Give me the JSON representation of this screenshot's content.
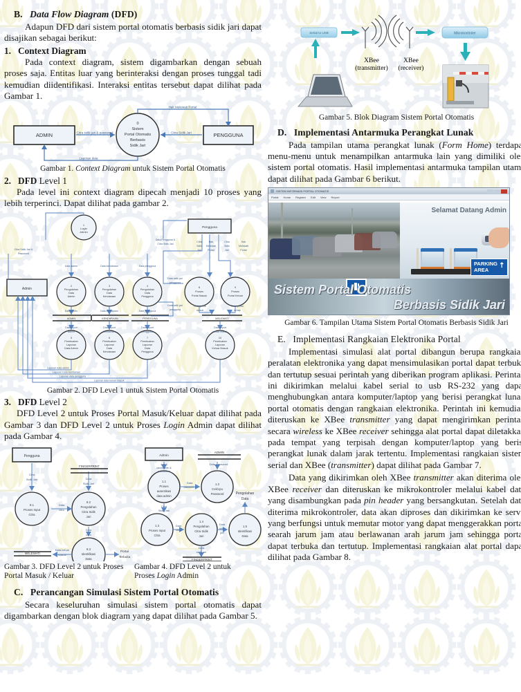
{
  "document": {
    "language": "id",
    "watermark": "its-gear-lotus-logo"
  },
  "left_column": {
    "section_b": {
      "letter": "B.",
      "title_italic": "Data Flow Diagram",
      "title_rest": "(DFD)",
      "para": "Adapun DFD dari sistem portal otomatis berbasis sidik jari dapat disajikan sebagai berikut:"
    },
    "item1": {
      "num": "1.",
      "title": "Context Diagram",
      "para": "Pada context diagram, sistem digambarkan dengan sebuah proses saja. Entitas luar yang berinteraksi dengan proses tunggal tadi kemudian diidentifikasi. Interaksi entitas tersebut dapat dilihat pada Gambar 1."
    },
    "figure1": {
      "caption_pre": "Gambar 1. ",
      "caption_italic": "Context Diagram",
      "caption_post": " untuk Sistem Portal Otomatis",
      "entities": [
        "ADMIN",
        "PENGGUNA"
      ],
      "process": [
        "0",
        "Sistem",
        "Portal Otomatis",
        "Berbasis",
        "Sidik Jari"
      ],
      "flows": [
        "Hak Melewati Portal",
        "Citra sidik jari & password",
        "Citra Sidik Jari",
        "Laporan data"
      ]
    },
    "item2": {
      "num": "2.",
      "title_bold": "DFD",
      "title_rest": " Level 1",
      "para": "Pada level ini context diagram dipecah menjadi 10 proses yang lebih terperinci. Dapat dilihat pada gambar 2."
    },
    "figure2": {
      "caption": "Gambar 2. DFD Level 1 untuk Sistem Portal Otomatis",
      "external_entities": [
        "Admin",
        "Pengguna"
      ],
      "processes": [
        {
          "id": "1",
          "label": "Login Admin"
        },
        {
          "id": "2",
          "label": "Pengolahan Data Admin"
        },
        {
          "id": "3",
          "label": "Pengolahan Data Kendaraan"
        },
        {
          "id": "4",
          "label": "Pengolahan Data Pengguna"
        },
        {
          "id": "8",
          "label": "Proses Portal Masuk"
        },
        {
          "id": "9",
          "label": "Proses Portal Keluar"
        },
        {
          "id": "5",
          "label": "Pembuatan Laporan Data Admin"
        },
        {
          "id": "6",
          "label": "Pembuatan Laporan Data Kendaraan"
        },
        {
          "id": "7",
          "label": "Pembuatan Laporan Data Pengguna"
        },
        {
          "id": "10",
          "label": "Pembuatan Laporan Keluar Masuk"
        }
      ],
      "datastores": [
        "ADMIN",
        "KENDARAAN",
        "PENGGUNA",
        "MELEWATI"
      ],
      "flows": [
        "Citra Sidik Jari & Password",
        "Data admin",
        "Data kendaraan",
        "Data pengguna",
        "Data Pengguna & Citra Sidik Jari",
        "Citra Sidik Jari",
        "Hak Melewati Portal",
        "Data sidik jari pengguna",
        "Data portal masuk",
        "Data portal keluar",
        "Data report admin",
        "Data report kendaraan",
        "Data report pengguna",
        "Data report keluar masuk",
        "Laporan data admin",
        "Laporan Data Kendaraan",
        "Laporan data pengguna",
        "Laporan data keluar masuk"
      ]
    },
    "item3": {
      "num": "3.",
      "title_bold": "DFD",
      "title_rest": " Level 2",
      "para_part1": "DFD Level 2 untuk Proses Portal Masuk/Keluar dapat dilihat pada Gambar 3 dan DFD Level 2 untuk Proses ",
      "para_italic": "Login",
      "para_part2": " Admin dapat dilihat pada Gambar 4."
    },
    "figure3": {
      "caption_line1": "Gambar 3. DFD Level 2 untuk Proses",
      "caption_line2": "Portal Masuk / Keluar",
      "entity": "Pengguna",
      "datastores": [
        "FINGERPRINT",
        "MELEWATI"
      ],
      "processes": [
        {
          "id": "8.1",
          "label": "Proses Input Citra"
        },
        {
          "id": "8.2",
          "label": "Pengolahan Citra Sidik Jari"
        },
        {
          "id": "8.3",
          "label": "Identifikasi Data"
        }
      ],
      "terminator": "Portal Terbuka",
      "flows": [
        "Citra Sidik Jari",
        "Data Sidik Jari",
        "Data citra",
        "Data citra",
        "Data keluar masuk"
      ]
    },
    "figure4": {
      "caption_pre_line1": "Gambar 4. DFD Level 2 untuk",
      "caption_line2_pre": "Proses ",
      "caption_line2_italic": "Login",
      "caption_line2_post": " Admin",
      "entity": "Admin",
      "datastores": [
        "ADMIN",
        "FINGERPRINT"
      ],
      "processes": [
        {
          "id": "1.1",
          "label": "Proses autentikasi data admin"
        },
        {
          "id": "1.2",
          "label": "Cek/cpu Password"
        },
        {
          "id": "1.3",
          "label": "Proses Input Citra"
        },
        {
          "id": "1.4",
          "label": "Pengolahan Citra Sidik Jari"
        },
        {
          "id": "1.5",
          "label": "Identifikasi Data"
        }
      ],
      "terminator": "Pengolahan Data",
      "flows": [
        "Input username & password",
        "Data password",
        "Data password",
        "Citra Sidik Jari",
        "Data citra",
        "Data sidik jari",
        "Data sidik jari"
      ]
    },
    "section_c": {
      "letter": "C.",
      "title": "Perancangan Simulasi Sistem Portal Otomatis",
      "para": "Secara keseluruhan simulasi sistem portal otomatis dapat digambarkan dengan blok diagram yang dapat dilihat pada Gambar 5."
    }
  },
  "right_column": {
    "figure5": {
      "caption": "Gambar 5. Blok Diagram Sistem Portal Otomatis",
      "blocks": [
        "Serial to USB",
        "Mikrokontroler"
      ],
      "labels": [
        {
          "line1": "XBee",
          "line2": "(transmitter)"
        },
        {
          "line1": "XBee",
          "line2": "(receiver)"
        }
      ],
      "icons": [
        "laptop-icon",
        "antenna-icon",
        "gate-photo"
      ]
    },
    "section_d": {
      "letter": "D.",
      "title": "Implementasi Antarmuka Perangkat Lunak",
      "para_1": "Pada tampilan utama perangkat lunak (",
      "para_italic": "Form Home",
      "para_2": ") terdapat menu-menu untuk menampilkan antarmuka lain yang dimiliki oleh sistem portal otomatis. Hasil implementasi antarmuka tampilan utama dapat dilihat pada Gambar 6 berikut."
    },
    "figure6": {
      "caption": "Gambar 6. Tampilan Utama Sistem Portal Otomatis Berbasis Sidik Jari",
      "app_window": {
        "title": "SISTEM INFORMASI PORTAL OTOMATIS",
        "menu": [
          "Portal",
          "Home",
          "Register",
          "Edit",
          "View",
          "Report"
        ],
        "welcome": "Selamat Datang Admin",
        "banner_line1": "Sistem Portal Otomatis",
        "banner_line2": "Berbasis Sidik Jari",
        "sign": "PARKING AREA",
        "sign_arrow": "↗"
      }
    },
    "section_e": {
      "letter": "E.",
      "title": "Implementasi Rangkaian Elektronika Portal",
      "para_1_a": "Implementasi simulasi alat portal dibangun berupa rangkaian peralatan elektronika yang dapat mensimulasikan portal dapat terbuka dan tertutup sesuai perintah yang diberikan program aplikasi. Perintah ini dikirimkan melalui kabel serial to usb RS-232 yang dapat menghubungkan antara komputer/laptop yang berisi perangkat lunak portal otomatis dengan rangkaian elektronika. Perintah ini kemudian diteruskan ke XBee ",
      "para_1_it1": "transmitter",
      "para_1_b": " yang dapat mengirimkan perintah secara ",
      "para_1_it2": "wireless",
      "para_1_c": " ke XBee ",
      "para_1_it3": "receiver",
      "para_1_d": " sehingga alat portal dapat diletakkan pada tempat yang terpisah dengan komputer/laptop yang berisi perangkat lunak dalam jarak tertentu. Implementasi rangkaian sistem serial dan XBee (",
      "para_1_it4": "transmitter",
      "para_1_e": ") dapat dilihat pada Gambar 7.",
      "para_2_a": "Data yang dikirimkan oleh XBee ",
      "para_2_it1": "transmitter",
      "para_2_b": " akan diterima oleh XBee ",
      "para_2_it2": "receiver",
      "para_2_c": " dan diteruskan ke mikrokontroler melalui kabel data yang disambungkan pada ",
      "para_2_it3": "pin header",
      "para_2_d": " yang bersangkutan. Setelah data diterima mikrokontroler, data akan diproses dan dikirimkan ke servo yang berfungsi untuk memutar motor yang dapat menggerakkan portal searah jarum jam atau berlawanan arah jarum jam sehingga portal dapat terbuka dan tertutup. Implementasi rangkaian alat portal dapat dilihat pada Gambar 8."
    }
  },
  "colors": {
    "diagram_stroke": "#4a79b8",
    "diagram_fill": "#eef3fa",
    "entity_stroke": "#2a2a2a",
    "accent_teal": "#2ab0b8",
    "watermark": "#e8e4c8"
  }
}
